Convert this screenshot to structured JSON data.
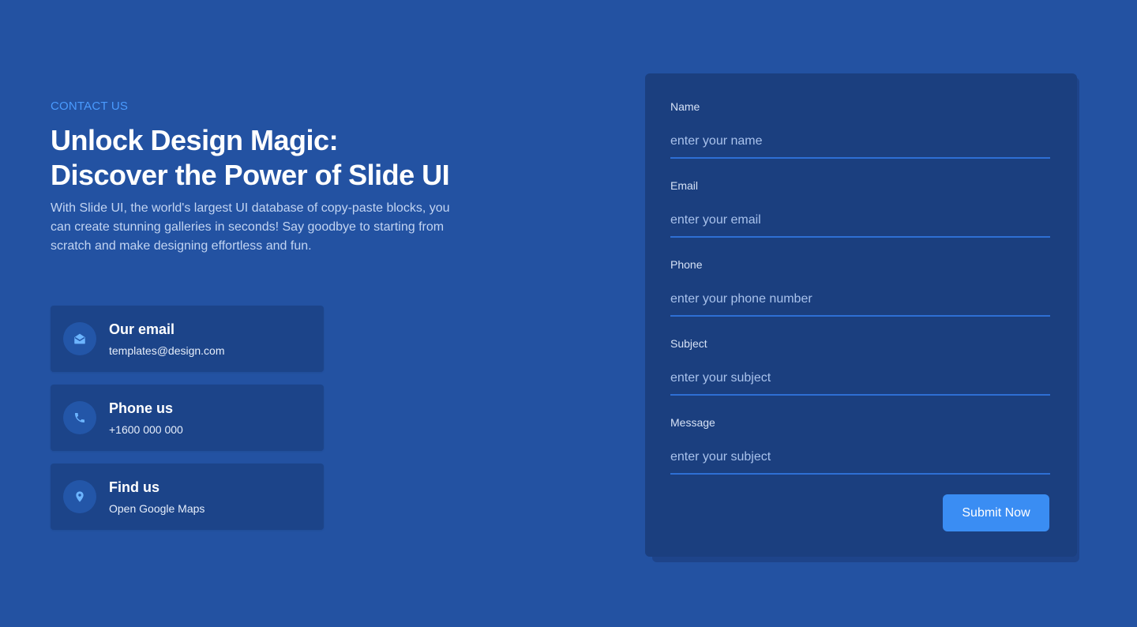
{
  "hero": {
    "eyebrow": "CONTACT US",
    "headline_line1": "Unlock Design Magic:",
    "headline_line2": "Discover the Power of Slide UI",
    "description": "With Slide UI, the world's largest UI database of copy-paste blocks, you can create stunning galleries in seconds! Say goodbye to starting from scratch and make designing effortless and fun."
  },
  "contact_cards": [
    {
      "title": "Our email",
      "value": "templates@design.com",
      "icon": "envelope-icon"
    },
    {
      "title": "Phone us",
      "value": "+1600 000 000",
      "icon": "phone-icon"
    },
    {
      "title": "Find us",
      "value": "Open Google Maps",
      "icon": "map-pin-icon"
    }
  ],
  "form": {
    "fields": [
      {
        "label": "Name",
        "placeholder": "enter your name",
        "value": ""
      },
      {
        "label": "Email",
        "placeholder": "enter your email",
        "value": ""
      },
      {
        "label": "Phone",
        "placeholder": "enter your phone number",
        "value": ""
      },
      {
        "label": "Subject",
        "placeholder": "enter your subject",
        "value": ""
      },
      {
        "label": "Message",
        "placeholder": "enter your subject",
        "value": ""
      }
    ],
    "submit_label": "Submit Now"
  },
  "colors": {
    "background": "#2352a2",
    "card": "#1c4489",
    "form": "#1b3f7f",
    "accent": "#3a8df3",
    "eyebrow": "#4a9bff"
  }
}
